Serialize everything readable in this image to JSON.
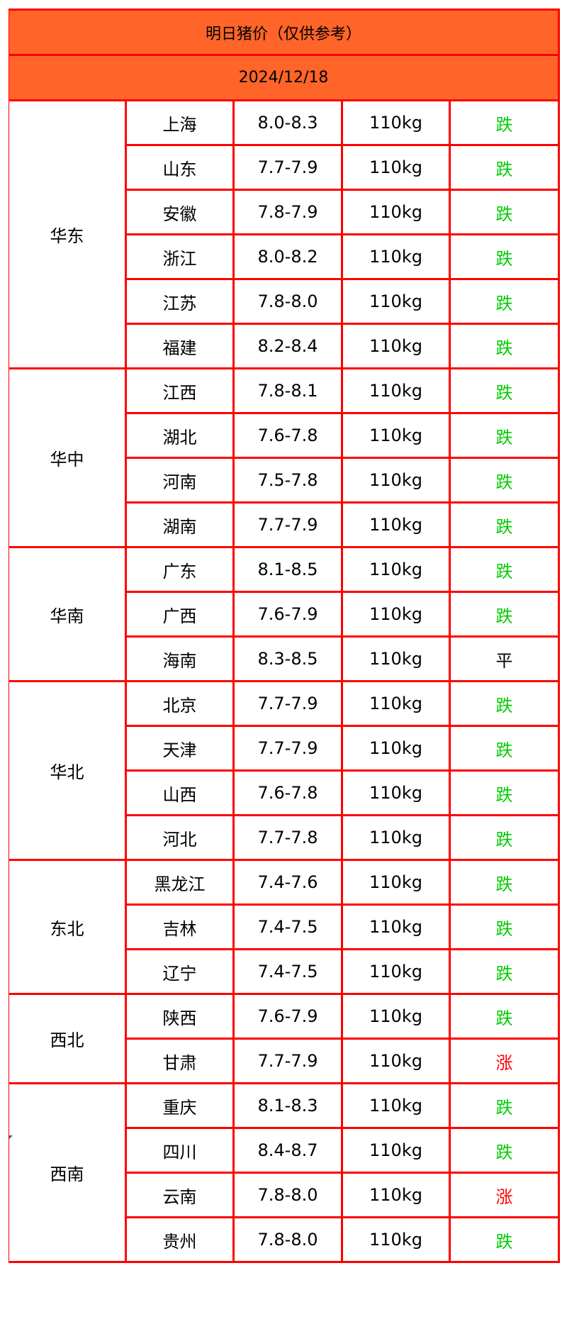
{
  "header": {
    "title": "明日猪价（仅供参考）",
    "date": "2024/12/18"
  },
  "colors": {
    "header_bg": "#ff6429",
    "border": "#ff0000",
    "down": "#00cc00",
    "up": "#ff0000",
    "flat": "#000000"
  },
  "regions": [
    {
      "name": "华东",
      "rows": [
        {
          "province": "上海",
          "price": "8.0-8.3",
          "weight": "110kg",
          "trend": "跌",
          "trend_type": "down"
        },
        {
          "province": "山东",
          "price": "7.7-7.9",
          "weight": "110kg",
          "trend": "跌",
          "trend_type": "down"
        },
        {
          "province": "安徽",
          "price": "7.8-7.9",
          "weight": "110kg",
          "trend": "跌",
          "trend_type": "down"
        },
        {
          "province": "浙江",
          "price": "8.0-8.2",
          "weight": "110kg",
          "trend": "跌",
          "trend_type": "down"
        },
        {
          "province": "江苏",
          "price": "7.8-8.0",
          "weight": "110kg",
          "trend": "跌",
          "trend_type": "down"
        },
        {
          "province": "福建",
          "price": "8.2-8.4",
          "weight": "110kg",
          "trend": "跌",
          "trend_type": "down"
        }
      ]
    },
    {
      "name": "华中",
      "rows": [
        {
          "province": "江西",
          "price": "7.8-8.1",
          "weight": "110kg",
          "trend": "跌",
          "trend_type": "down"
        },
        {
          "province": "湖北",
          "price": "7.6-7.8",
          "weight": "110kg",
          "trend": "跌",
          "trend_type": "down"
        },
        {
          "province": "河南",
          "price": "7.5-7.8",
          "weight": "110kg",
          "trend": "跌",
          "trend_type": "down"
        },
        {
          "province": "湖南",
          "price": "7.7-7.9",
          "weight": "110kg",
          "trend": "跌",
          "trend_type": "down"
        }
      ]
    },
    {
      "name": "华南",
      "rows": [
        {
          "province": "广东",
          "price": "8.1-8.5",
          "weight": "110kg",
          "trend": "跌",
          "trend_type": "down"
        },
        {
          "province": "广西",
          "price": "7.6-7.9",
          "weight": "110kg",
          "trend": "跌",
          "trend_type": "down"
        },
        {
          "province": "海南",
          "price": "8.3-8.5",
          "weight": "110kg",
          "trend": "平",
          "trend_type": "flat"
        }
      ]
    },
    {
      "name": "华北",
      "rows": [
        {
          "province": "北京",
          "price": "7.7-7.9",
          "weight": "110kg",
          "trend": "跌",
          "trend_type": "down"
        },
        {
          "province": "天津",
          "price": "7.7-7.9",
          "weight": "110kg",
          "trend": "跌",
          "trend_type": "down"
        },
        {
          "province": "山西",
          "price": "7.6-7.8",
          "weight": "110kg",
          "trend": "跌",
          "trend_type": "down"
        },
        {
          "province": "河北",
          "price": "7.7-7.8",
          "weight": "110kg",
          "trend": "跌",
          "trend_type": "down"
        }
      ]
    },
    {
      "name": "东北",
      "rows": [
        {
          "province": "黑龙江",
          "price": "7.4-7.6",
          "weight": "110kg",
          "trend": "跌",
          "trend_type": "down"
        },
        {
          "province": "吉林",
          "price": "7.4-7.5",
          "weight": "110kg",
          "trend": "跌",
          "trend_type": "down"
        },
        {
          "province": "辽宁",
          "price": "7.4-7.5",
          "weight": "110kg",
          "trend": "跌",
          "trend_type": "down"
        }
      ]
    },
    {
      "name": "西北",
      "rows": [
        {
          "province": "陕西",
          "price": "7.6-7.9",
          "weight": "110kg",
          "trend": "跌",
          "trend_type": "down"
        },
        {
          "province": "甘肃",
          "price": "7.7-7.9",
          "weight": "110kg",
          "trend": "涨",
          "trend_type": "up"
        }
      ]
    },
    {
      "name": "西南",
      "rows": [
        {
          "province": "重庆",
          "price": "8.1-8.3",
          "weight": "110kg",
          "trend": "跌",
          "trend_type": "down"
        },
        {
          "province": "四川",
          "price": "8.4-8.7",
          "weight": "110kg",
          "trend": "跌",
          "trend_type": "down"
        },
        {
          "province": "云南",
          "price": "7.8-8.0",
          "weight": "110kg",
          "trend": "涨",
          "trend_type": "up"
        },
        {
          "province": "贵州",
          "price": "7.8-8.0",
          "weight": "110kg",
          "trend": "跌",
          "trend_type": "down"
        }
      ]
    }
  ]
}
